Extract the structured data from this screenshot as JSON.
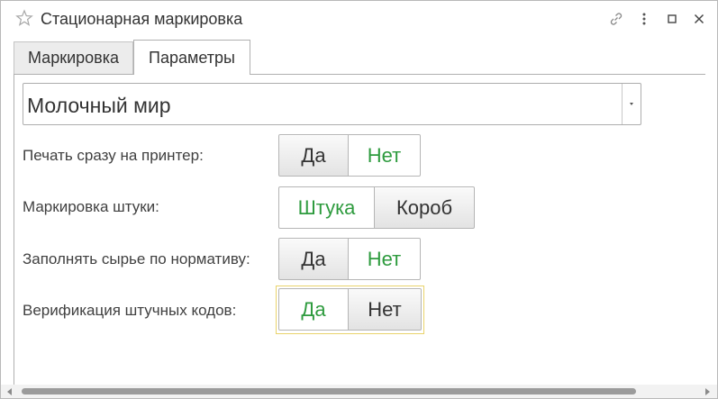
{
  "window": {
    "title": "Стационарная маркировка",
    "icons": [
      "star-icon",
      "link-icon",
      "more-vertical-icon",
      "maximize-icon",
      "close-icon"
    ]
  },
  "tabs": [
    {
      "label": "Маркировка",
      "active": false
    },
    {
      "label": "Параметры",
      "active": true
    }
  ],
  "organization_select": {
    "value": "Молочный мир"
  },
  "rows": [
    {
      "label": "Печать сразу на принтер:",
      "options": [
        "Да",
        "Нет"
      ],
      "selected": "Да"
    },
    {
      "label": "Маркировка штуки:",
      "options": [
        "Штука",
        "Короб"
      ],
      "selected": "Короб"
    },
    {
      "label": "Заполнять сырье по нормативу:",
      "options": [
        "Да",
        "Нет"
      ],
      "selected": "Да"
    },
    {
      "label": "Верификация штучных кодов:",
      "options": [
        "Да",
        "Нет"
      ],
      "selected": "Нет"
    }
  ],
  "colors": {
    "unselected_option_text": "#2e9b3e",
    "focus_border": "#e9d36c"
  }
}
